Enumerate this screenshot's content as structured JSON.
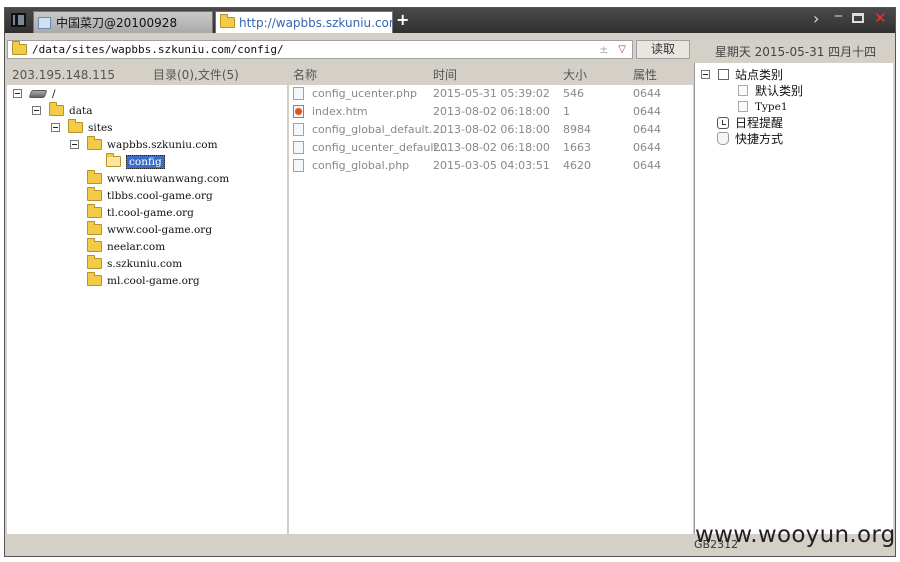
{
  "tabs": [
    {
      "label": "中国菜刀@20100928",
      "active": false
    },
    {
      "label": "http://wapbbs.szkuniu.com/c...",
      "active": true
    }
  ],
  "new_tab_label": "+",
  "window_controls": {
    "chevron": "›",
    "minimize": "‒",
    "close": "✕"
  },
  "address": {
    "path": "/data/sites/wapbbs.szkuniu.com/config/",
    "pm": "±",
    "dropdown": "▽"
  },
  "read_button": "读取",
  "datetime": "星期天 2015-05-31 四月十四",
  "left_header": {
    "ip": "203.195.148.115",
    "summary": "目录(0),文件(5)"
  },
  "columns": {
    "name": "名称",
    "time": "时间",
    "size": "大小",
    "attr": "属性"
  },
  "tree": [
    {
      "label": "/",
      "icon": "drive-icon",
      "level": 0,
      "expanded": true
    },
    {
      "label": "data",
      "icon": "folder-icon",
      "level": 1,
      "expanded": true
    },
    {
      "label": "sites",
      "icon": "folder-icon",
      "level": 2,
      "expanded": true
    },
    {
      "label": "wapbbs.szkuniu.com",
      "icon": "folder-icon",
      "level": 3,
      "expanded": true
    },
    {
      "label": "config",
      "icon": "folder-open-icon",
      "level": 4,
      "selected": true
    },
    {
      "label": "www.niuwanwang.com",
      "icon": "folder-icon",
      "level": 3
    },
    {
      "label": "tlbbs.cool-game.org",
      "icon": "folder-icon",
      "level": 3
    },
    {
      "label": "tl.cool-game.org",
      "icon": "folder-icon",
      "level": 3
    },
    {
      "label": "www.cool-game.org",
      "icon": "folder-icon",
      "level": 3
    },
    {
      "label": "neelar.com",
      "icon": "folder-icon",
      "level": 3
    },
    {
      "label": "s.szkuniu.com",
      "icon": "folder-icon",
      "level": 3
    },
    {
      "label": "ml.cool-game.org",
      "icon": "folder-icon",
      "level": 3
    }
  ],
  "files": [
    {
      "name": "config_ucenter.php",
      "time": "2015-05-31 05:39:02",
      "size": "546",
      "attr": "0644",
      "icon": "php-file-icon"
    },
    {
      "name": "index.htm",
      "time": "2013-08-02 06:18:00",
      "size": "1",
      "attr": "0644",
      "icon": "html-file-icon"
    },
    {
      "name": "config_global_default....",
      "time": "2013-08-02 06:18:00",
      "size": "8984",
      "attr": "0644",
      "icon": "php-file-icon"
    },
    {
      "name": "config_ucenter_default...",
      "time": "2013-08-02 06:18:00",
      "size": "1663",
      "attr": "0644",
      "icon": "php-file-icon"
    },
    {
      "name": "config_global.php",
      "time": "2015-03-05 04:03:51",
      "size": "4620",
      "attr": "0644",
      "icon": "php-file-icon"
    }
  ],
  "side_tree": {
    "site_category": "站点类别",
    "default_category": "默认类别",
    "type1": "Type1",
    "schedule": "日程提醒",
    "shortcuts": "快捷方式"
  },
  "status_encoding": "GB2312",
  "watermark": "www.wooyun.org"
}
